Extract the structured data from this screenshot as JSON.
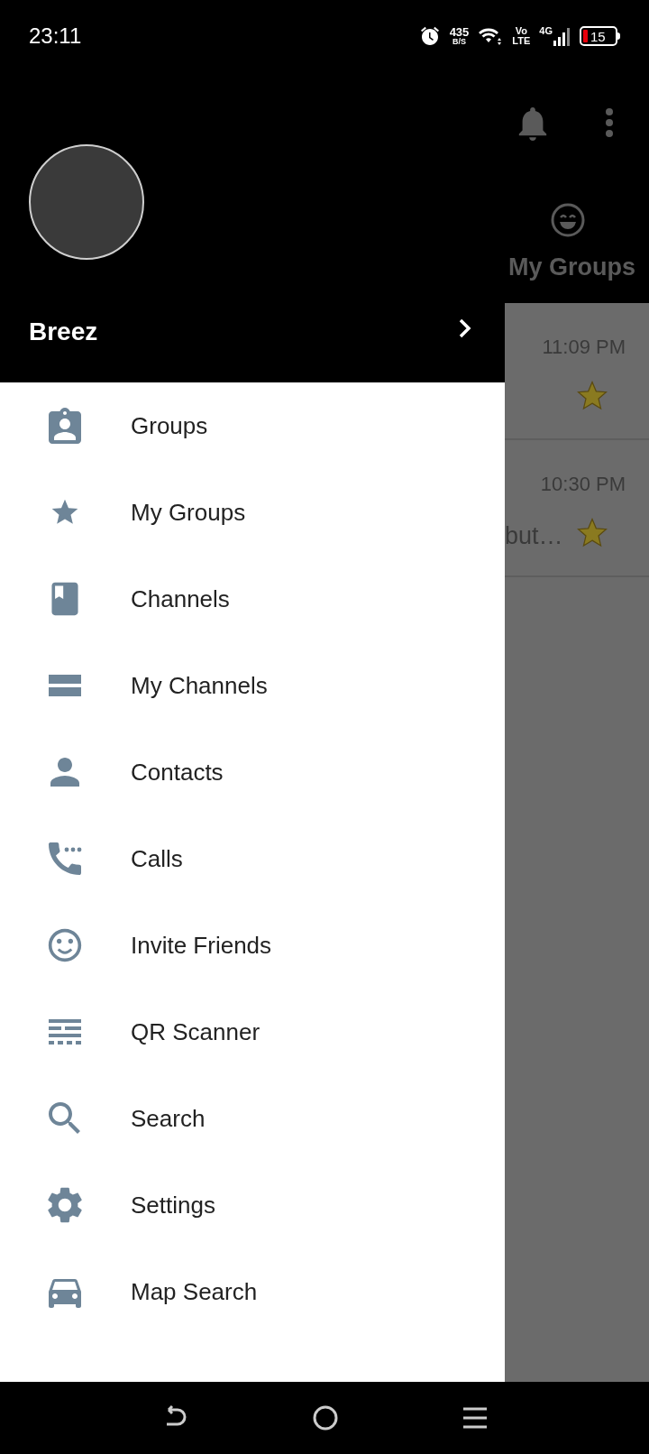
{
  "status_bar": {
    "time": "23:11",
    "net_speed": "435",
    "net_unit": "B/S",
    "volte_top": "Vo",
    "volte_bottom": "LTE",
    "network": "4G",
    "battery": "15"
  },
  "background": {
    "tab_label": "My Groups",
    "rows": [
      {
        "time": "11:09 PM",
        "starred": true
      },
      {
        "time": "10:30 PM",
        "preview": "but…",
        "starred": true
      }
    ]
  },
  "drawer": {
    "user_name": "Breez",
    "items": [
      {
        "label": "Groups"
      },
      {
        "label": "My Groups"
      },
      {
        "label": "Channels"
      },
      {
        "label": "My Channels"
      },
      {
        "label": "Contacts"
      },
      {
        "label": "Calls"
      },
      {
        "label": "Invite Friends"
      },
      {
        "label": "QR Scanner"
      },
      {
        "label": "Search"
      },
      {
        "label": "Settings"
      },
      {
        "label": "Map Search"
      }
    ]
  }
}
